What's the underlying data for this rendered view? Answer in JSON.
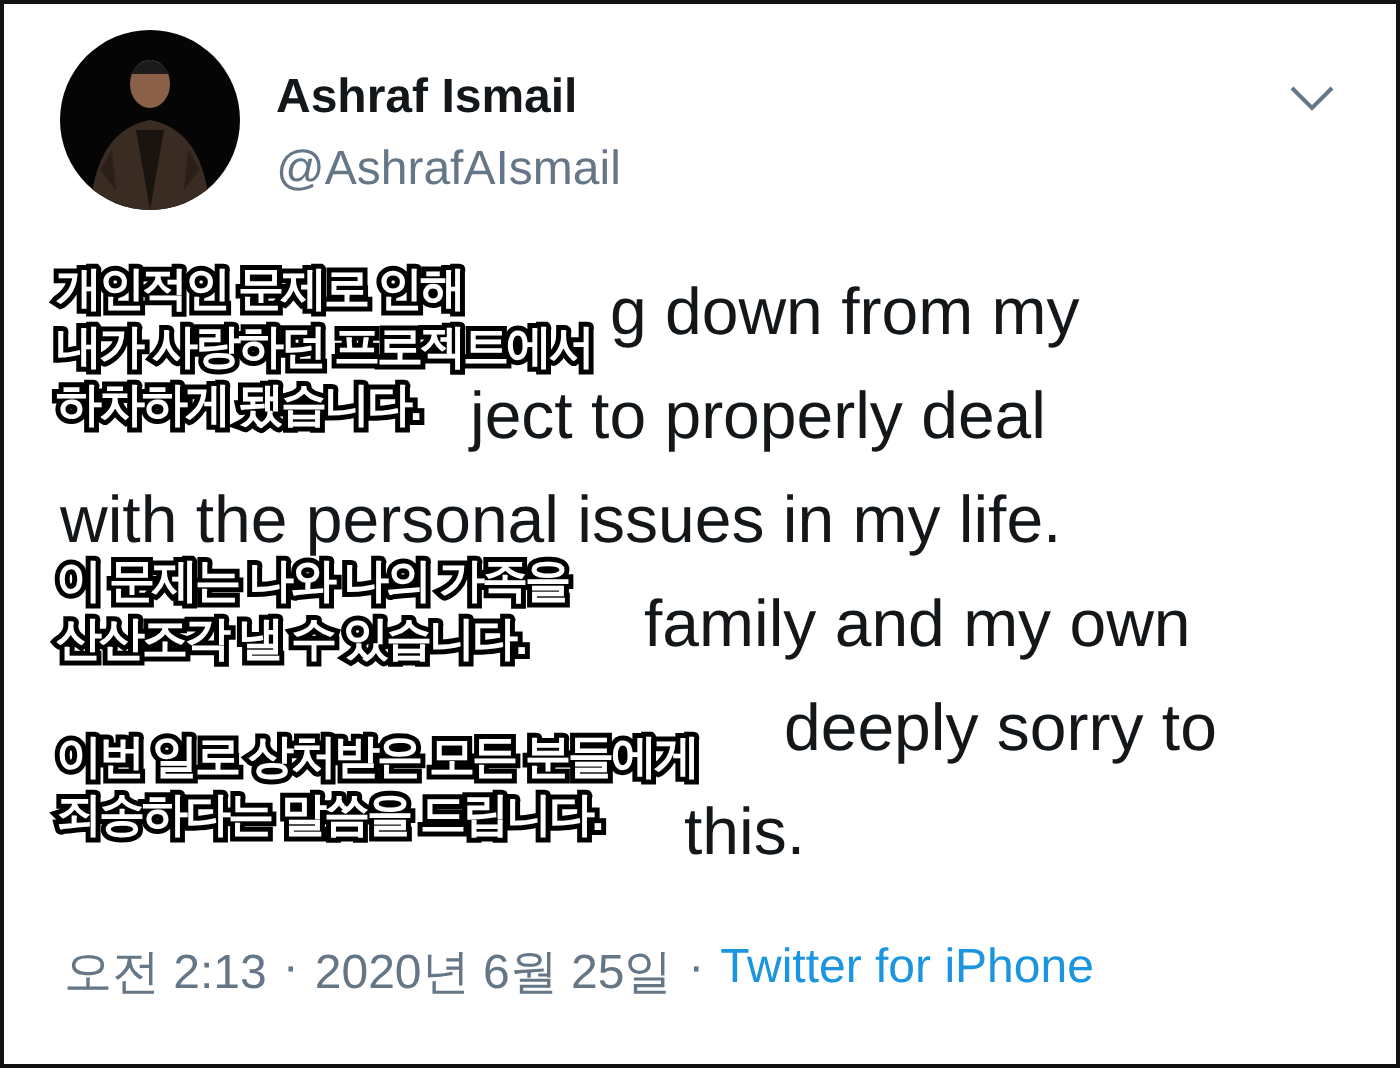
{
  "author": {
    "name": "Ashraf Ismail",
    "handle": "@AshrafAIsmail"
  },
  "tweet_lines": [
    "g down from my",
    "ject to properly deal",
    "with the personal issues in my life.",
    "family and my own",
    "deeply sorry to",
    "this."
  ],
  "captions": [
    [
      "개인적인 문제로 인해",
      "내가 사랑하던 프로젝트에서",
      "하차하게 됐습니다."
    ],
    [
      "이 문제는 나와 나의 가족을",
      "산산조각 낼 수 있습니다."
    ],
    [
      "이번 일로 상처받은 모든 분들에게",
      "죄송하다는 말씀을 드립니다."
    ]
  ],
  "meta": [
    {
      "kind": "text",
      "text": "오전 2:13"
    },
    {
      "kind": "sep",
      "text": "·"
    },
    {
      "kind": "text",
      "text": "2020년 6월 25일"
    },
    {
      "kind": "sep",
      "text": "·"
    },
    {
      "kind": "link",
      "text": "Twitter for iPhone"
    }
  ]
}
